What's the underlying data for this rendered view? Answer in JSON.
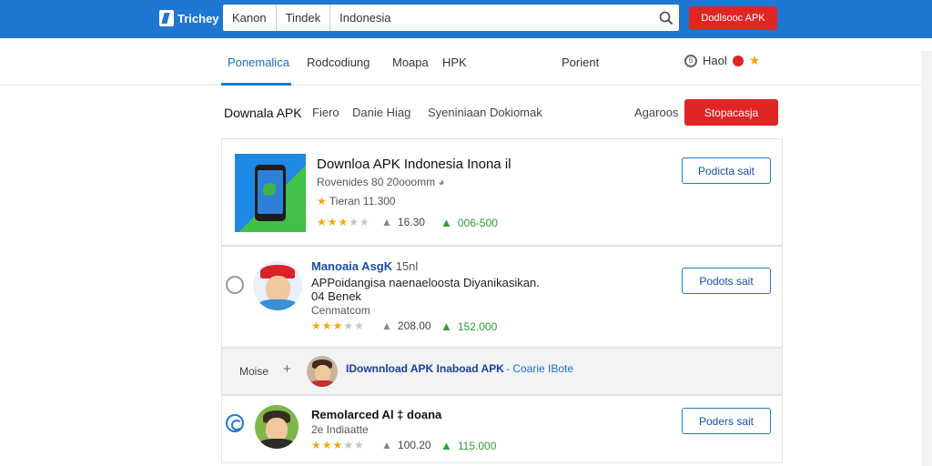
{
  "topbar": {
    "logo_text": "Trichey",
    "search_segments": [
      "Kanon",
      "Tindek"
    ],
    "search_query": "Indonesia",
    "cta_label": "Dodlsooc APK"
  },
  "nav": {
    "tabs": [
      "Ponemalica",
      "Rodcodiung",
      "Moapa",
      "HPK",
      "Porient"
    ],
    "right_label": "Haol",
    "right_circle": "6"
  },
  "subnav": {
    "items": [
      "Downala APK",
      "Fiero",
      "Danie Hiag",
      "Syeniniaan Dokiomak"
    ],
    "right_label": "Agaroos",
    "button_label": "Stopacasja"
  },
  "apps": [
    {
      "title": "Downloa APK Indonesia Inona il",
      "subtitle": "Rovenides 80 20ooomm",
      "extra": "Tieran 11.300",
      "rating": 3.5,
      "likes": "16.30",
      "downloads": "006-500",
      "button": "Podicta sait"
    },
    {
      "title": "Manoaia AsgK",
      "title_suffix": "15nl",
      "line1": "APPoidangisa naenaeloosta Diyanikasikan.",
      "line2": "04 Benek",
      "line3": "Cenmatcom",
      "rating": 3.5,
      "likes": "208.00",
      "downloads": "152.000",
      "button": "Podots sait"
    },
    {
      "title": "Remolarced Al ‡ doana",
      "subtitle": "2e Indiaatte",
      "rating": 3.5,
      "likes": "100.20",
      "downloads": "115.000",
      "button": "Poders sait"
    }
  ],
  "band": {
    "label": "Moise",
    "title": "IDownnload APK Inaboad APK",
    "subtitle": "- Coarie IBote"
  },
  "colors": {
    "brand_blue": "#1e78d2",
    "cta_red": "#e02624",
    "star": "#f2a613",
    "green": "#2e9d34"
  }
}
